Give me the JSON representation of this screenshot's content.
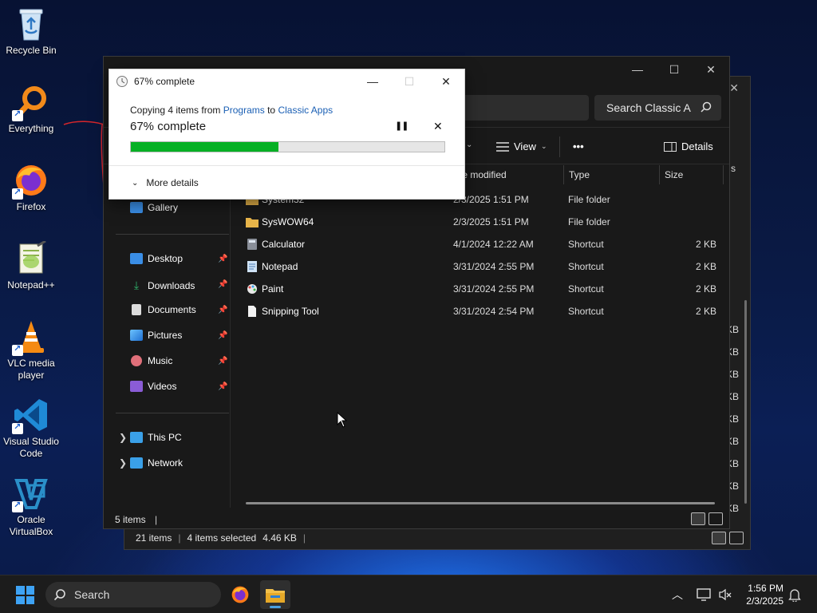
{
  "desktop": {
    "icons": [
      {
        "label": "Recycle Bin",
        "icon": "recycle-bin-icon"
      },
      {
        "label": "Everything",
        "icon": "everything-search-icon"
      },
      {
        "label": "Firefox",
        "icon": "firefox-icon"
      },
      {
        "label": "Notepad++",
        "icon": "notepad-plus-plus-icon"
      },
      {
        "label": "VLC media player",
        "icon": "vlc-icon"
      },
      {
        "label": "Visual Studio Code",
        "icon": "vscode-icon"
      },
      {
        "label": "Oracle VirtualBox",
        "icon": "virtualbox-icon"
      }
    ]
  },
  "background_window": {
    "status_items": "21 items",
    "status_selected": "4 items selected",
    "status_size": "4.46 KB",
    "side_size_label": "KB",
    "header_fragment": "s"
  },
  "explorer": {
    "search_placeholder": "Search Classic A",
    "toolbar": {
      "view_label": "View",
      "more_label": "•••",
      "details_label": "Details"
    },
    "columns": {
      "date_modified": "te modified",
      "type": "Type",
      "size": "Size"
    },
    "nav": {
      "gallery": "Gallery",
      "quick_access": [
        {
          "label": "Desktop",
          "icon": "desktop-folder-icon",
          "color": "#3a8ee6"
        },
        {
          "label": "Downloads",
          "icon": "download-arrow-icon",
          "color": "#2fb36b"
        },
        {
          "label": "Documents",
          "icon": "documents-icon",
          "color": "#dcdcdc"
        },
        {
          "label": "Pictures",
          "icon": "pictures-icon",
          "color": "#3aa0e8"
        },
        {
          "label": "Music",
          "icon": "music-icon",
          "color": "#e0707a"
        },
        {
          "label": "Videos",
          "icon": "videos-icon",
          "color": "#8a5cd6"
        }
      ],
      "this_pc": "This PC",
      "network": "Network"
    },
    "files": [
      {
        "name": "System32",
        "date": "2/3/2025 1:51 PM",
        "type": "File folder",
        "size": "",
        "icon": "folder-icon"
      },
      {
        "name": "SysWOW64",
        "date": "2/3/2025 1:51 PM",
        "type": "File folder",
        "size": "",
        "icon": "folder-icon"
      },
      {
        "name": "Calculator",
        "date": "4/1/2024 12:22 AM",
        "type": "Shortcut",
        "size": "2 KB",
        "icon": "calculator-icon"
      },
      {
        "name": "Notepad",
        "date": "3/31/2024 2:55 PM",
        "type": "Shortcut",
        "size": "2 KB",
        "icon": "notepad-icon"
      },
      {
        "name": "Paint",
        "date": "3/31/2024 2:55 PM",
        "type": "Shortcut",
        "size": "2 KB",
        "icon": "paint-icon"
      },
      {
        "name": "Snipping Tool",
        "date": "3/31/2024 2:54 PM",
        "type": "Shortcut",
        "size": "2 KB",
        "icon": "snipping-tool-icon"
      }
    ],
    "status": "5 items"
  },
  "copy_dialog": {
    "title": "67% complete",
    "copy_prefix": "Copying 4 items from",
    "source": "Programs",
    "to_word": "to",
    "destination": "Classic Apps",
    "percent_text": "67% complete",
    "progress_fraction": 0.47,
    "more_details": "More details",
    "progress_color": "#06b025"
  },
  "taskbar": {
    "search_label": "Search",
    "time": "1:56 PM",
    "date": "2/3/2025"
  }
}
